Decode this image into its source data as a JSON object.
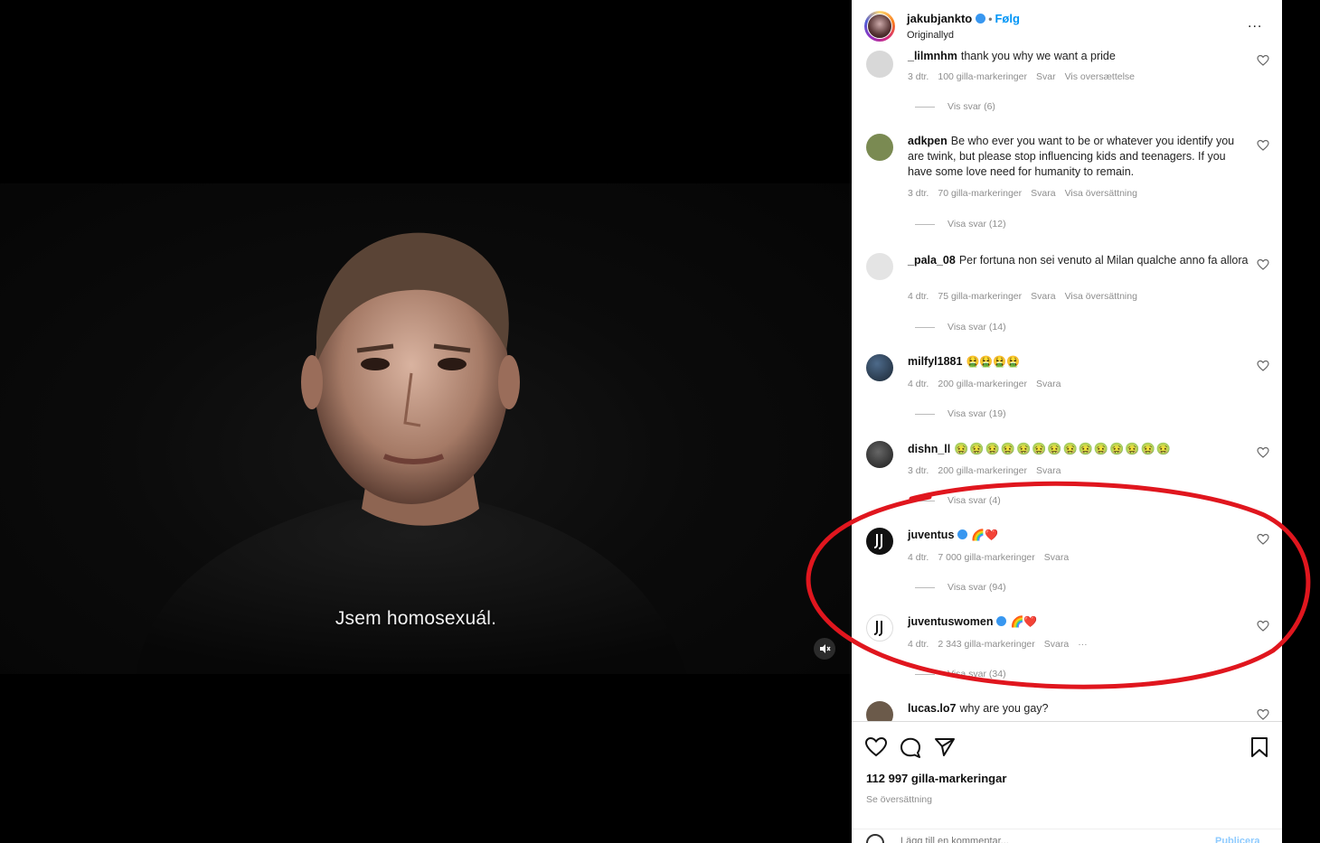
{
  "video": {
    "subtitle": "Jsem homosexuál.",
    "mute_icon": "speaker-muted-icon"
  },
  "post": {
    "username": "jakubjankto",
    "follow_label": "Følg",
    "audio_label": "Originallyd",
    "more_label": "..."
  },
  "comments": [
    {
      "user": "_lilmnhm",
      "text": "thank you why we want a pride",
      "age": "3 dtr.",
      "likes": "100 gilla-markeringer",
      "reply": "Svar",
      "translation": "Vis oversættelse",
      "replies": "Vis svar (6)",
      "avatar_color": "#d8d8d8"
    },
    {
      "user": "adkpen",
      "text": "Be who ever you want to be or whatever you identify you are twink, but please stop influencing kids and teenagers. If you have some love need for humanity to remain.",
      "age": "3 dtr.",
      "likes": "70 gilla-markeringer",
      "reply": "Svara",
      "translation": "Visa översättning",
      "replies": "Visa svar (12)",
      "avatar_color": "#7a8a52"
    },
    {
      "user": "_pala_08",
      "text": "Per fortuna non sei venuto al Milan qualche anno fa allora",
      "age": "4 dtr.",
      "likes": "75 gilla-markeringer",
      "reply": "Svara",
      "translation": "Visa översättning",
      "replies": "Visa svar (14)",
      "avatar_color": "#e4e4e4"
    },
    {
      "user": "milfyl1881",
      "text": "🤮🤮🤮🤮",
      "age": "4 dtr.",
      "likes": "200 gilla-markeringer",
      "reply": "Svara",
      "translation": "",
      "replies": "Visa svar (19)",
      "avatar_color": "#2d3f55"
    },
    {
      "user": "dishn_ll",
      "text": "🤢🤢🤢🤢🤢🤢🤢🤢🤢🤢🤢🤢🤢🤢",
      "age": "3 dtr.",
      "likes": "200 gilla-markeringer",
      "reply": "Svara",
      "translation": "",
      "replies": "Visa svar (4)",
      "avatar_color": "#3a3a3a"
    },
    {
      "user": "juventus",
      "text": "🌈❤️",
      "age": "4 dtr.",
      "likes": "7 000 gilla-markeringer",
      "reply": "Svara",
      "translation": "",
      "replies": "Visa svar (94)",
      "avatar_color": "#111111"
    },
    {
      "user": "juventuswomen",
      "text": "🌈❤️",
      "age": "4 dtr.",
      "likes": "2 343 gilla-markeringer",
      "reply": "Svara",
      "translation": "",
      "replies": "Visa svar (34)",
      "avatar_color": "#ffffff"
    },
    {
      "user": "lucas.lo7",
      "text": "why are you gay?",
      "age": "",
      "likes": "",
      "reply": "",
      "translation": "",
      "replies": "",
      "avatar_color": "#6b5a4a"
    }
  ],
  "actions": {
    "likes": "112 997 gilla-markeringar",
    "translate": "Se översättning",
    "add_comment_placeholder": "Lägg till en kommentar...",
    "post_label": "Publicera"
  },
  "colors": {
    "highlight": "#e0161e",
    "link": "#0095f6",
    "verified": "#3897f0"
  }
}
